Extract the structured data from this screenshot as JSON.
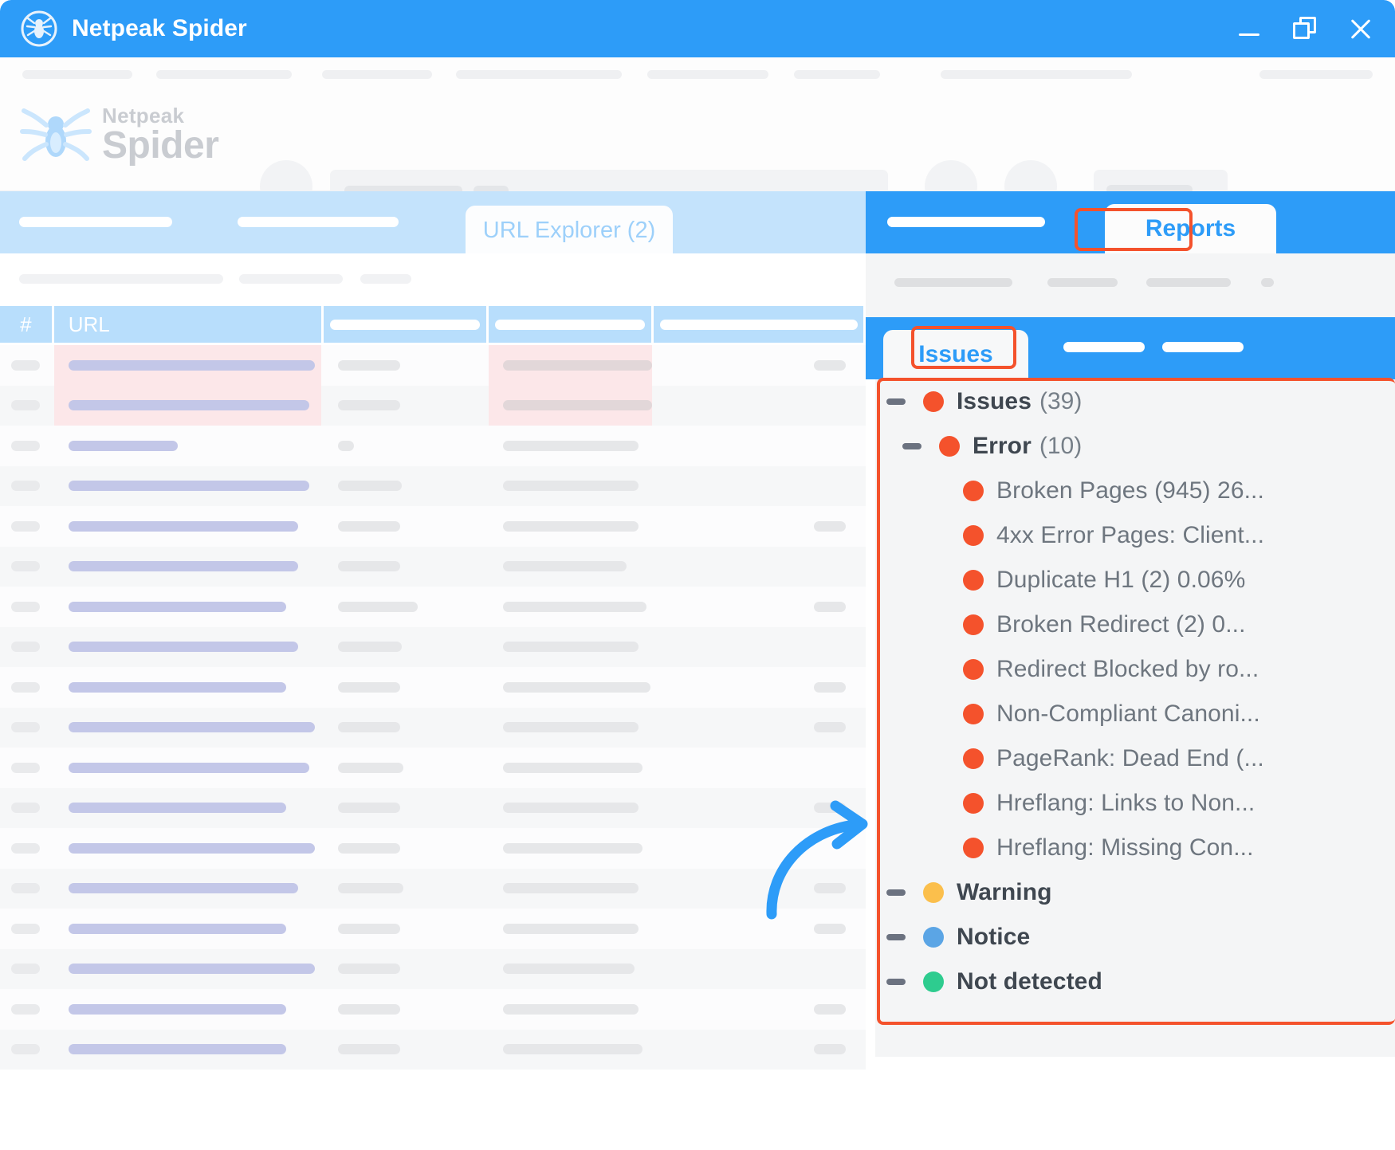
{
  "window": {
    "title": "Netpeak Spider",
    "logo_icon": "spider-icon",
    "controls": {
      "minimize": "minimize-icon",
      "maximize": "restore-icon",
      "close": "close-icon"
    }
  },
  "brand": {
    "top": "Netpeak",
    "bottom": "Spider",
    "mark_icon": "spider-logo-icon"
  },
  "main": {
    "active_tab": "URL Explorer (2)",
    "table": {
      "columns": [
        "#",
        "URL",
        "",
        "",
        ""
      ],
      "row_count": 18
    }
  },
  "sidebar": {
    "tab_reports": "Reports",
    "tab_issues": "Issues",
    "tree": {
      "root": {
        "label": "Issues",
        "count": "(39)",
        "color": "#F4522C",
        "toggle": "collapse-toggle"
      },
      "error": {
        "label": "Error",
        "count": "(10)",
        "color": "#F4522C",
        "toggle": "collapse-toggle"
      },
      "error_items": [
        {
          "label": "Broken Pages (945) 26...",
          "color": "#F4522C"
        },
        {
          "label": "4xx Error Pages: Client...",
          "color": "#F4522C"
        },
        {
          "label": "Duplicate H1 (2) 0.06%",
          "color": "#F4522C"
        },
        {
          "label": "Broken Redirect (2) 0...",
          "color": "#F4522C"
        },
        {
          "label": "Redirect Blocked by ro...",
          "color": "#F4522C"
        },
        {
          "label": "Non-Compliant Canoni...",
          "color": "#F4522C"
        },
        {
          "label": "PageRank: Dead End (...",
          "color": "#F4522C"
        },
        {
          "label": "Hreflang: Links to Non...",
          "color": "#F4522C"
        },
        {
          "label": "Hreflang: Missing Con...",
          "color": "#F4522C"
        }
      ],
      "categories": [
        {
          "label": "Warning",
          "color": "#FBBF4C",
          "toggle": "collapse-toggle"
        },
        {
          "label": "Notice",
          "color": "#5BA5E5",
          "toggle": "collapse-toggle"
        },
        {
          "label": "Not detected",
          "color": "#2ECC8F",
          "toggle": "collapse-toggle"
        }
      ]
    }
  },
  "annotations": {
    "arrow_icon": "curved-arrow-icon",
    "highlight_color": "#F4522C",
    "boxes": [
      "reports-tab-highlight",
      "issues-tab-highlight",
      "issues-tree-highlight"
    ]
  },
  "colors": {
    "titlebar": "#2D9CF8",
    "accent": "#2D9CF8",
    "tab_strip": "#C4E3FC",
    "table_header": "#B8DEFC",
    "error": "#F4522C",
    "warning": "#FBBF4C",
    "notice": "#5BA5E5",
    "ok": "#2ECC8F"
  }
}
